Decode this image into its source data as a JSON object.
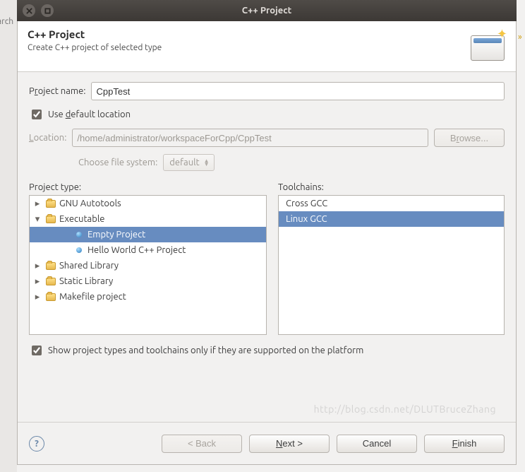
{
  "window": {
    "title": "C++ Project",
    "close_icon": "close",
    "restore_icon": "restore"
  },
  "banner": {
    "heading": "C++ Project",
    "subtext": "Create C++ project of selected type"
  },
  "form": {
    "project_name_label_pre": "P",
    "project_name_label_u": "r",
    "project_name_label_post": "oject name:",
    "project_name_value": "CppTest",
    "use_default_location_pre": "Use ",
    "use_default_location_u": "d",
    "use_default_location_post": "efault location",
    "use_default_location_checked": true,
    "location_label_pre": "",
    "location_label_u": "L",
    "location_label_post": "ocation:",
    "location_value": "/home/administrator/workspaceForCpp/CppTest",
    "browse_label_pre": "B",
    "browse_label_u": "r",
    "browse_label_post": "owse...",
    "filesystem_label": "Choose file system:",
    "filesystem_value": "default"
  },
  "project_type": {
    "title": "Project type:",
    "items": [
      {
        "label": "GNU Autotools",
        "expanded": false,
        "icon": "folder"
      },
      {
        "label": "Executable",
        "expanded": true,
        "icon": "folder"
      },
      {
        "label": "Empty Project",
        "icon": "bullet",
        "indent": 2,
        "selected": true
      },
      {
        "label": "Hello World C++ Project",
        "icon": "bullet",
        "indent": 2
      },
      {
        "label": "Shared Library",
        "expanded": false,
        "icon": "folder"
      },
      {
        "label": "Static Library",
        "expanded": false,
        "icon": "folder"
      },
      {
        "label": "Makefile project",
        "expanded": false,
        "icon": "folder"
      }
    ]
  },
  "toolchains": {
    "title": "Toolchains:",
    "items": [
      {
        "label": "Cross GCC"
      },
      {
        "label": "Linux GCC",
        "selected": true
      }
    ]
  },
  "filter": {
    "label": "Show project types and toolchains only if they are supported on the platform",
    "checked": true
  },
  "buttons": {
    "back": "< Back",
    "next_u": "N",
    "next_post": "ext >",
    "cancel": "Cancel",
    "finish_u": "F",
    "finish_post": "inish"
  },
  "bg": {
    "left_text": "arch"
  },
  "watermark": "http://blog.csdn.net/DLUTBruceZhang"
}
